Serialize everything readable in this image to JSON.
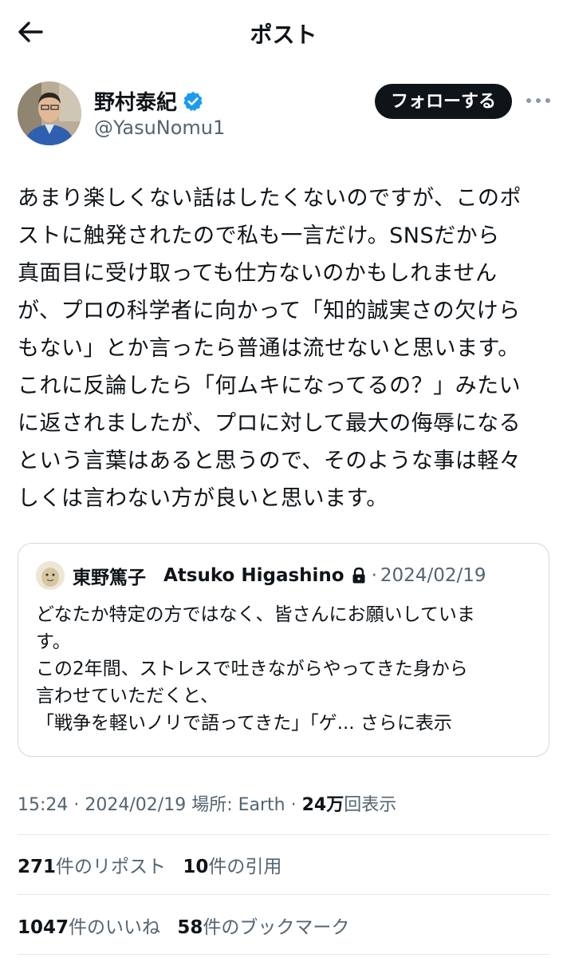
{
  "header": {
    "title": "ポスト"
  },
  "author": {
    "name": "野村泰紀",
    "handle": "@YasuNomu1",
    "follow_label": "フォローする"
  },
  "post": {
    "text": "あまり楽しくない話はしたくないのですが、このポ\nストに触発されたので私も一言だけ。SNSだから\n真面目に受け取っても仕方ないのかもしれません\nが、プロの科学者に向かって「知的誠実さの欠けら\nもない」とか言ったら普通は流せないと思います。\nこれに反論したら「何ムキになってるの？」みたい\nに返されましたが、プロに対して最大の侮辱になる\nという言葉はあると思うので、そのような事は軽々\nしくは言わない方が良いと思います。"
  },
  "quote": {
    "name": "東野篤子",
    "display": "Atsuko Higashino",
    "separator": "·",
    "date": "2024/02/19",
    "text": "どなたか特定の方ではなく、皆さんにお願いしていま\nす。\nこの2年間、ストレスで吐きながらやってきた身から\n言わせていただくと、\n「戦争を軽いノリで語ってきた」「ゲ...",
    "show_more": " さらに表示"
  },
  "meta": {
    "time": "15:24",
    "sep1": " · ",
    "date": "2024/02/19",
    "location": " 場所: Earth",
    "sep2": " · ",
    "views": "24万",
    "views_label": "回表示"
  },
  "stats": {
    "reposts": "271",
    "reposts_label": "件のリポスト",
    "quotes": "10",
    "quotes_label": "件の引用",
    "likes": "1047",
    "likes_label": "件のいいね",
    "bookmarks": "58",
    "bookmarks_label": "件のブックマーク"
  },
  "colors": {
    "verified": "#1d9bf0",
    "text_primary": "#0f1419",
    "text_secondary": "#536471",
    "border": "#cfd9de"
  },
  "icons": {
    "back": "arrow-left-icon",
    "verified": "verified-badge-icon",
    "more": "more-dots-icon",
    "lock": "lock-icon"
  }
}
